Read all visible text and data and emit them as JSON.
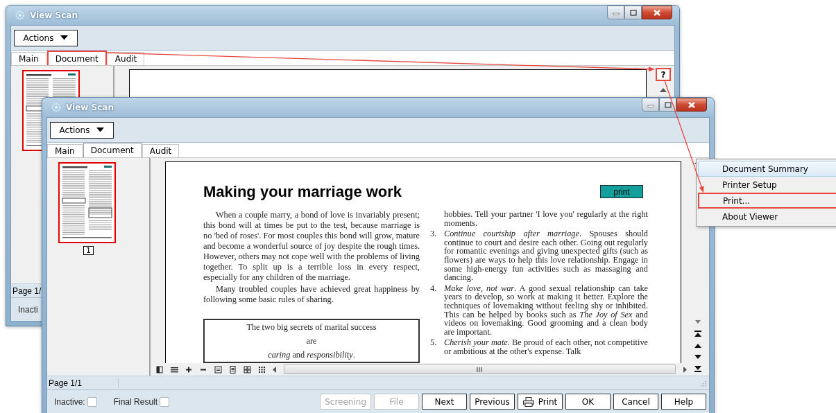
{
  "windows": [
    {
      "kind": "background",
      "title": "View Scan",
      "actions_button": "Actions",
      "tabs": [
        {
          "label": "Main",
          "selected": false,
          "highlighted": false
        },
        {
          "label": "Document",
          "selected": true,
          "highlighted": true
        },
        {
          "label": "Audit",
          "selected": false,
          "highlighted": false
        }
      ],
      "thumbnails": [
        {
          "selected": true
        }
      ],
      "help_button": {
        "label": "?",
        "highlighted": true
      },
      "status": "Page 1/",
      "footer": {
        "checkboxes": [
          {
            "label": "Inacti"
          }
        ]
      }
    },
    {
      "kind": "foreground",
      "title": "View Scan",
      "actions_button": "Actions",
      "tabs": [
        {
          "label": "Main",
          "selected": false,
          "highlighted": false
        },
        {
          "label": "Document",
          "selected": true,
          "highlighted": false
        },
        {
          "label": "Audit",
          "selected": false,
          "highlighted": false
        }
      ],
      "thumbnails": [
        {
          "page": "1",
          "selected": true
        }
      ],
      "document": {
        "heading": "Making your marriage work",
        "print_button": "print",
        "left_column": [
          {
            "kind": "paragraph",
            "text": "When a couple marry, a bond of love is invariably present; this bond will at times be put to the test, because marriage is no 'bed of roses'. For most couples this bond will grow, mature and become a wonderful source of joy despite the rough times. However, others may not cope well with the problems of living together. To split up is a terrible loss in every respect, especially for any children of the marriage."
          },
          {
            "kind": "paragraph",
            "text": "Many troubled couples have achieved great happiness by following some basic rules of sharing."
          },
          {
            "kind": "box",
            "lines": [
              "The two big secrets of marital success",
              "are",
              "*caring* and *responsibility*."
            ]
          }
        ],
        "right_column": [
          {
            "kind": "paragraph",
            "text": "hobbies. Tell your partner 'I love you' regularly at the right moments."
          },
          {
            "kind": "item",
            "number": "3.",
            "text": "*Continue courtship after marriage*. Spouses should continue to court and desire each other. Going out regularly for romantic evenings and giving unexpected gifts (such as flowers) are ways to help this love relationship. Engage in some high-energy fun activities such as massaging and dancing."
          },
          {
            "kind": "item",
            "number": "4.",
            "text": "*Make love, not war*. A good sexual relationship can take years to develop, so work at making it better. Explore the techniques of lovemaking without feeling shy or inhibited. This can be helped by books such as *The Joy of Sex* and videos on lovemaking. Good grooming and a clean body are important."
          },
          {
            "kind": "item",
            "number": "5.",
            "text": "*Cherish your mate*. Be proud of each other, not competitive or ambitious at the other's expense. Talk"
          }
        ]
      },
      "status": "Page 1/1",
      "footer": {
        "checkboxes": [
          {
            "label": "Inactive:",
            "checked": false
          },
          {
            "label": "Final Result",
            "checked": false
          }
        ],
        "buttons": [
          {
            "kind": "plain",
            "label": "Screening",
            "disabled": true
          },
          {
            "kind": "plain",
            "label": "File",
            "disabled": true
          },
          {
            "kind": "plain",
            "label": "Next",
            "disabled": false
          },
          {
            "kind": "plain",
            "label": "Previous",
            "disabled": false
          },
          {
            "kind": "icon",
            "label": "Print",
            "disabled": false
          },
          {
            "kind": "plain",
            "label": "OK",
            "disabled": false
          },
          {
            "kind": "plain",
            "label": "Cancel",
            "disabled": false
          },
          {
            "kind": "plain",
            "label": "Help",
            "disabled": false
          }
        ]
      }
    }
  ],
  "context_menu": {
    "items": [
      {
        "label": "Document Summary",
        "selected": true,
        "highlighted": false
      },
      {
        "label": "Printer Setup",
        "selected": false,
        "highlighted": false
      },
      {
        "label": "Print...",
        "selected": false,
        "highlighted": true
      },
      {
        "label": "About Viewer",
        "selected": false,
        "highlighted": false
      }
    ]
  }
}
